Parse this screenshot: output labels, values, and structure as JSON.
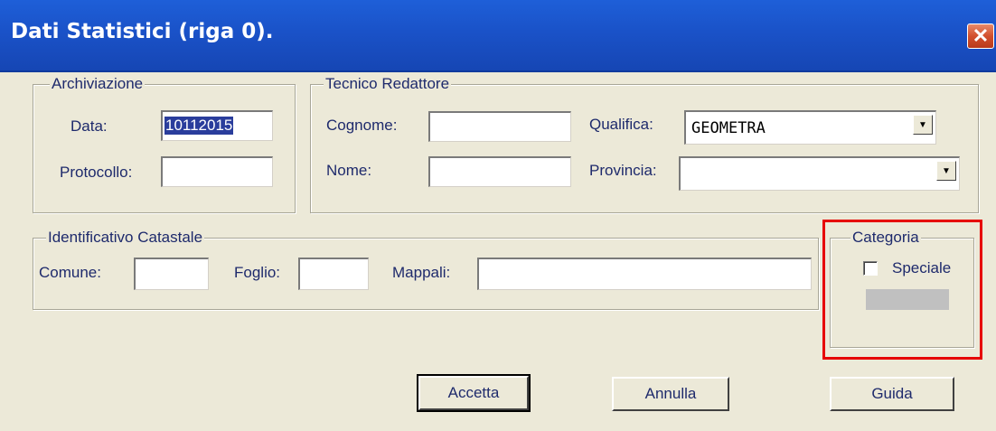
{
  "window": {
    "title": "Dati Statistici  (riga 0).",
    "close_glyph": "✕"
  },
  "archiviazione": {
    "legend": "Archiviazione",
    "data_label": "Data:",
    "data_value": "10112015",
    "protocollo_label": "Protocollo:",
    "protocollo_value": ""
  },
  "tecnico": {
    "legend": "Tecnico Redattore",
    "cognome_label": "Cognome:",
    "cognome_value": "",
    "nome_label": "Nome:",
    "nome_value": "",
    "qualifica_label": "Qualifica:",
    "qualifica_value": "GEOMETRA",
    "provincia_label": "Provincia:",
    "provincia_value": ""
  },
  "catastale": {
    "legend": "Identificativo Catastale",
    "comune_label": "Comune:",
    "comune_value": "",
    "foglio_label": "Foglio:",
    "foglio_value": "",
    "mappali_label": "Mappali:",
    "mappali_value": ""
  },
  "categoria": {
    "legend": "Categoria",
    "speciale_label": "Speciale",
    "speciale_checked": false
  },
  "buttons": {
    "accetta": "Accetta",
    "annulla": "Annulla",
    "guida": "Guida"
  },
  "colors": {
    "titlebar": "#1a52c8",
    "dialog_bg": "#ece9d8",
    "label_text": "#1e2a6c",
    "highlight": "#e60000",
    "close_button": "#d2502d"
  },
  "icons": {
    "close": "close-icon",
    "combo_arrow": "chevron-down-icon"
  }
}
